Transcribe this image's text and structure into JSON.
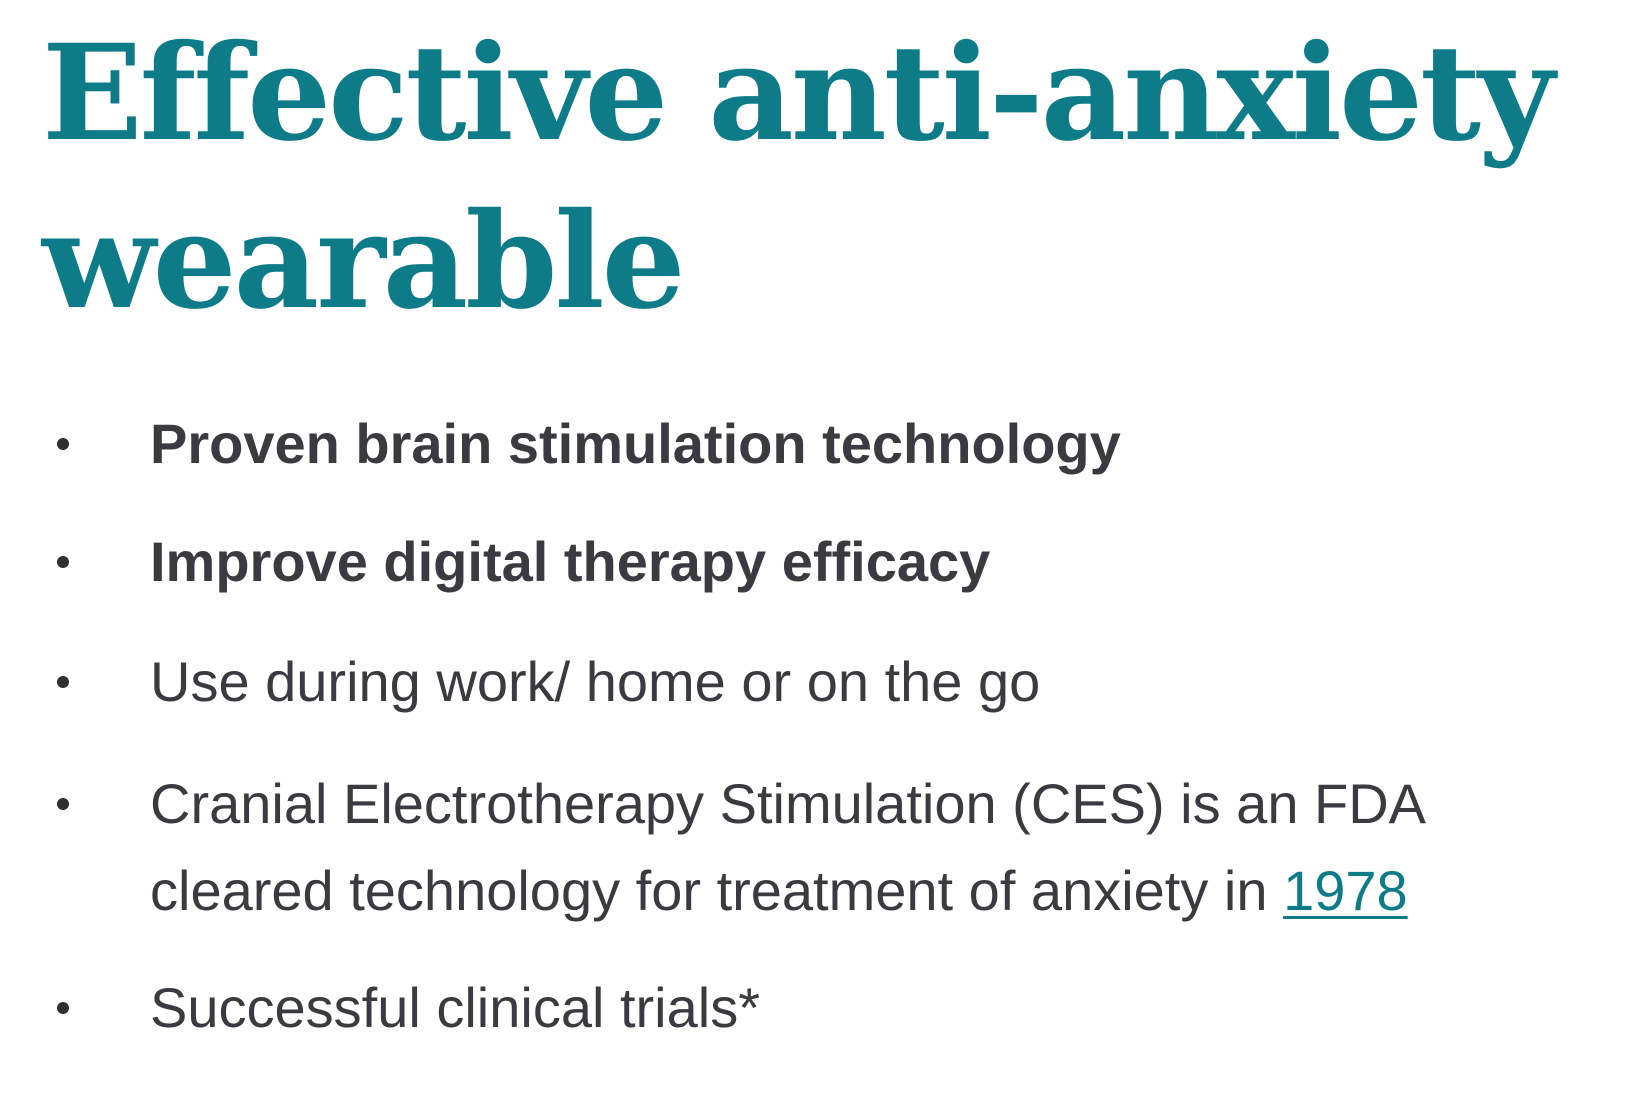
{
  "headline": {
    "line1": "Effective anti-anxiety",
    "line2": "wearable"
  },
  "features": [
    {
      "text": "Proven brain stimulation technology",
      "bold": true
    },
    {
      "text": "Improve digital therapy efficacy",
      "bold": true
    },
    {
      "text": "Use during work/ home or on the go",
      "bold": false
    },
    {
      "text": "Cranial Electrotherapy Stimulation (CES) is an FDA cleared technology for treatment of anxiety in ",
      "link_text": "1978",
      "bold": false
    },
    {
      "text": "Successful clinical trials*",
      "bold": false
    }
  ],
  "colors": {
    "headline": "#0e7c88",
    "body_text": "#3a3a40",
    "link": "#0e7c88"
  }
}
